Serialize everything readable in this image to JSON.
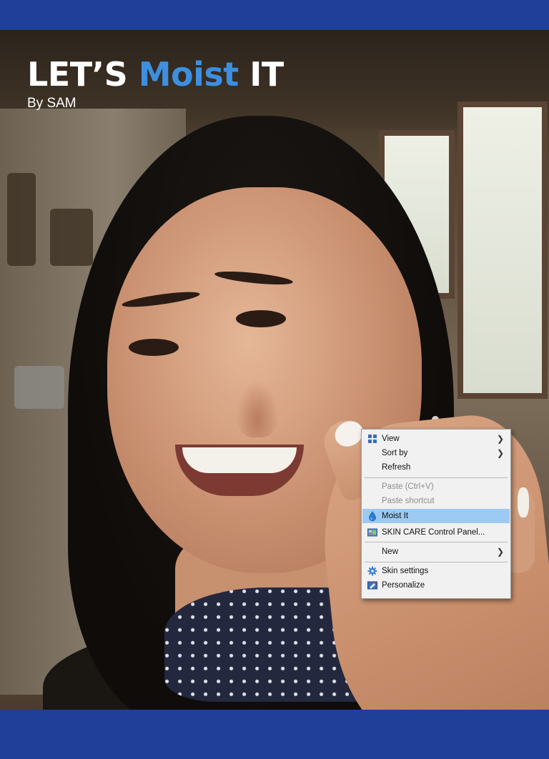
{
  "poster": {
    "title_prefix": "LET’S ",
    "title_accent": "Moist",
    "title_suffix": " IT",
    "byline": "By SAM",
    "accent_color": "#3d8fe0",
    "band_color": "#1f3f98"
  },
  "context_menu": {
    "items": [
      {
        "label": "View",
        "icon": "view-grid-icon",
        "submenu": true
      },
      {
        "label": "Sort by",
        "submenu": true
      },
      {
        "label": "Refresh"
      },
      {
        "label": "Paste (Ctrl+V)",
        "disabled": true
      },
      {
        "label": "Paste shortcut",
        "disabled": true
      },
      {
        "label": "Moist It",
        "icon": "water-drop-icon",
        "highlighted": true
      },
      {
        "label": "SKIN CARE Control Panel...",
        "icon": "control-panel-icon"
      },
      {
        "label": "New",
        "submenu": true
      },
      {
        "label": "Skin settings",
        "icon": "gear-icon"
      },
      {
        "label": "Personalize",
        "icon": "personalize-icon"
      }
    ],
    "submenu_arrow": "❯"
  }
}
